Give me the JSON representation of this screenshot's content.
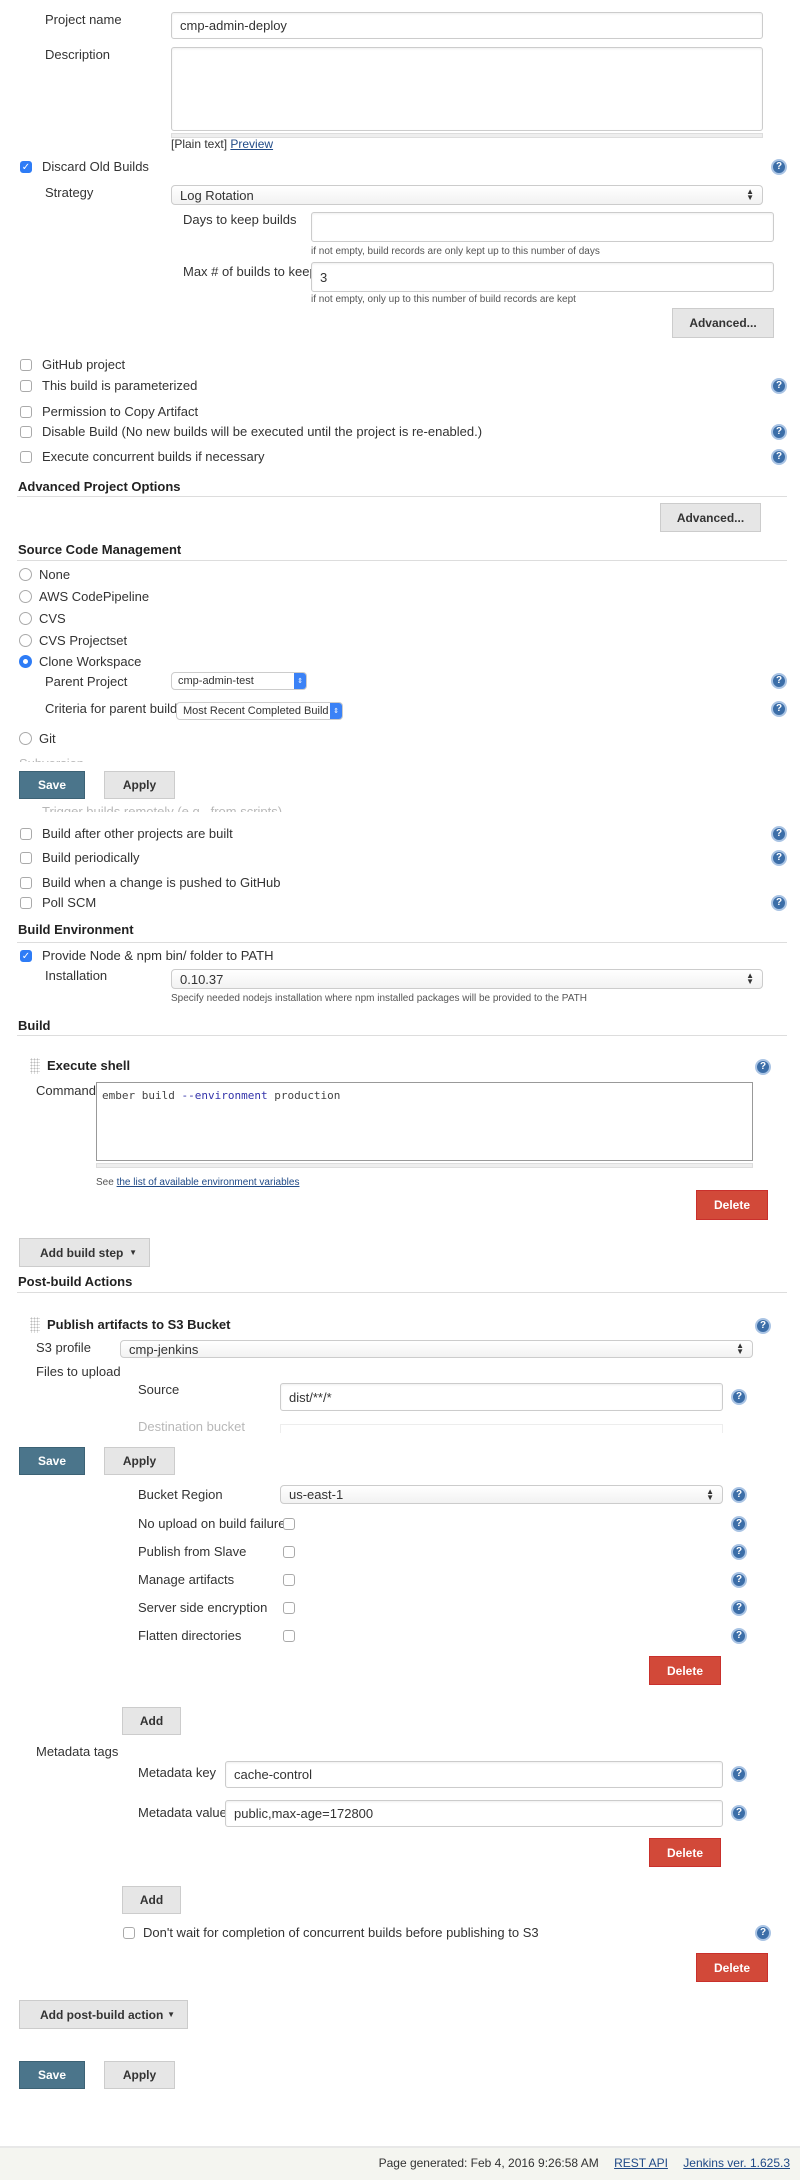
{
  "general": {
    "project_name_label": "Project name",
    "project_name": "cmp-admin-deploy",
    "description_label": "Description",
    "description": "",
    "plain_text": "[Plain text]",
    "preview": "Preview",
    "discard_old_builds": "Discard Old Builds",
    "discard_checked": true,
    "strategy_label": "Strategy",
    "strategy": "Log Rotation",
    "days_label": "Days to keep builds",
    "days_value": "",
    "days_hint": "if not empty, build records are only kept up to this number of days",
    "max_label": "Max # of builds to keep",
    "max_value": "3",
    "max_hint": "if not empty, only up to this number of build records are kept",
    "advanced": "Advanced...",
    "options": [
      {
        "label": "GitHub project",
        "checked": false
      },
      {
        "label": "This build is parameterized",
        "checked": false
      },
      {
        "label": "Permission to Copy Artifact",
        "checked": false
      },
      {
        "label": "Disable Build (No new builds will be executed until the project is re-enabled.)",
        "checked": false
      },
      {
        "label": "Execute concurrent builds if necessary",
        "checked": false
      }
    ]
  },
  "advanced_project": {
    "title": "Advanced Project Options",
    "advanced": "Advanced..."
  },
  "scm": {
    "title": "Source Code Management",
    "options": [
      "None",
      "AWS CodePipeline",
      "CVS",
      "CVS Projectset",
      "Clone Workspace",
      "Git",
      "Subversion"
    ],
    "selected": "Clone Workspace",
    "parent_label": "Parent Project",
    "parent_value": "cmp-admin-test",
    "criteria_label": "Criteria for parent build",
    "criteria_value": "Most Recent Completed Build"
  },
  "buttons": {
    "save": "Save",
    "apply": "Apply",
    "delete": "Delete",
    "add": "Add"
  },
  "triggers": {
    "items": [
      "Trigger builds remotely (e.g., from scripts)",
      "Build after other projects are built",
      "Build periodically",
      "Build when a change is pushed to GitHub",
      "Poll SCM"
    ]
  },
  "build_env": {
    "title": "Build Environment",
    "node_label": "Provide Node & npm bin/ folder to PATH",
    "node_checked": true,
    "installation_label": "Installation",
    "installation": "0.10.37",
    "installation_hint": "Specify needed nodejs installation where npm installed packages will be provided to the PATH"
  },
  "build": {
    "title": "Build",
    "step_title": "Execute shell",
    "command_label": "Command",
    "cmd_1": "ember build ",
    "cmd_2": "--environment",
    "cmd_3": " production",
    "see": "See ",
    "env_link": "the list of available environment variables",
    "add_step": "Add build step"
  },
  "post": {
    "title": "Post-build Actions",
    "step_title": "Publish artifacts to S3 Bucket",
    "profile_label": "S3 profile",
    "profile": "cmp-jenkins",
    "files_label": "Files to upload",
    "source_label": "Source",
    "source": "dist/**/*",
    "dest_label": "Destination bucket",
    "region_label": "Bucket Region",
    "region": "us-east-1",
    "flags": [
      {
        "label": "No upload on build failure",
        "checked": false
      },
      {
        "label": "Publish from Slave",
        "checked": false
      },
      {
        "label": "Manage artifacts",
        "checked": false
      },
      {
        "label": "Server side encryption",
        "checked": false
      },
      {
        "label": "Flatten directories",
        "checked": false
      }
    ],
    "metadata_label": "Metadata tags",
    "key_label": "Metadata key",
    "key": "cache-control",
    "value_label": "Metadata value",
    "value": "public,max-age=172800",
    "dont_wait": "Don't wait for completion of concurrent builds before publishing to S3",
    "add_action": "Add post-build action"
  },
  "footer": {
    "generated": "Page generated: Feb 4, 2016 9:26:58 AM",
    "rest_api": "REST API",
    "version": "Jenkins ver. 1.625.3"
  },
  "colors": {
    "save": "#4b758b",
    "delete": "#d24939",
    "help": "#3c6ea8",
    "checkbox": "#2e7cf6"
  }
}
